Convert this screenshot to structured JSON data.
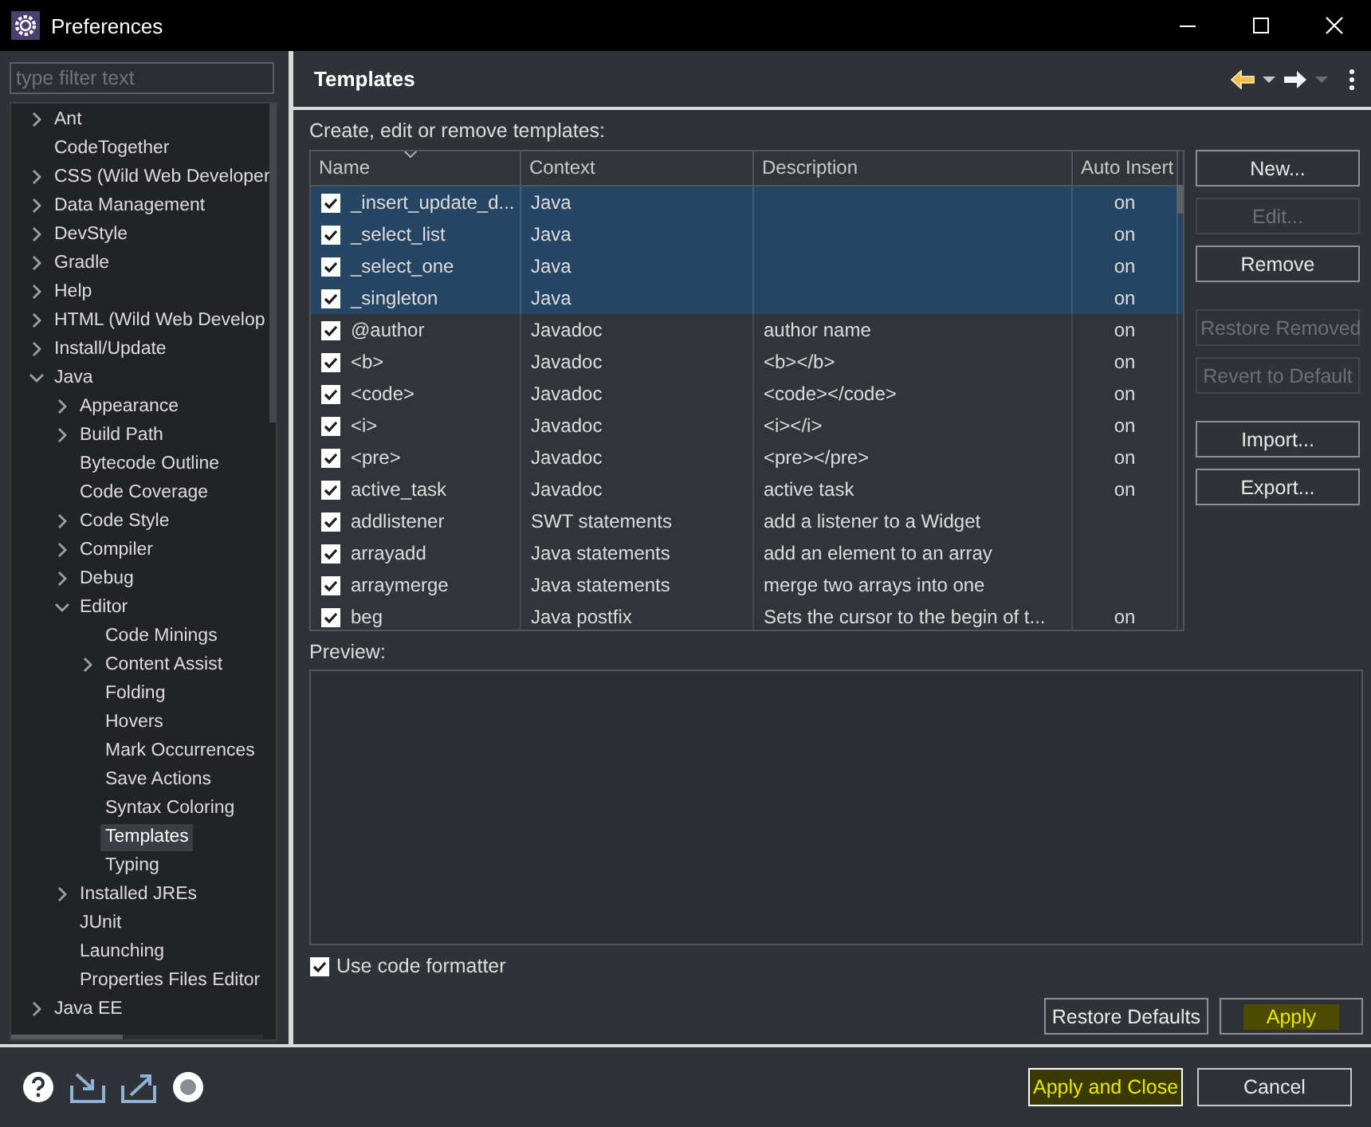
{
  "window": {
    "title": "Preferences"
  },
  "filter": {
    "placeholder": "type filter text"
  },
  "tree": [
    {
      "label": "Ant",
      "expandable": true,
      "expanded": false,
      "selected": false
    },
    {
      "label": "CodeTogether",
      "expandable": false,
      "selected": false
    },
    {
      "label": "CSS (Wild Web Developer",
      "expandable": true,
      "expanded": false,
      "selected": false
    },
    {
      "label": "Data Management",
      "expandable": true,
      "expanded": false,
      "selected": false
    },
    {
      "label": "DevStyle",
      "expandable": true,
      "expanded": false,
      "selected": false
    },
    {
      "label": "Gradle",
      "expandable": true,
      "expanded": false,
      "selected": false
    },
    {
      "label": "Help",
      "expandable": true,
      "expanded": false,
      "selected": false
    },
    {
      "label": "HTML (Wild Web Develop",
      "expandable": true,
      "expanded": false,
      "selected": false
    },
    {
      "label": "Install/Update",
      "expandable": true,
      "expanded": false,
      "selected": false
    },
    {
      "label": "Java",
      "expandable": true,
      "expanded": true,
      "selected": false,
      "children": [
        {
          "label": "Appearance",
          "expandable": true,
          "expanded": false,
          "selected": false
        },
        {
          "label": "Build Path",
          "expandable": true,
          "expanded": false,
          "selected": false
        },
        {
          "label": "Bytecode Outline",
          "expandable": false,
          "selected": false
        },
        {
          "label": "Code Coverage",
          "expandable": false,
          "selected": false
        },
        {
          "label": "Code Style",
          "expandable": true,
          "expanded": false,
          "selected": false
        },
        {
          "label": "Compiler",
          "expandable": true,
          "expanded": false,
          "selected": false
        },
        {
          "label": "Debug",
          "expandable": true,
          "expanded": false,
          "selected": false
        },
        {
          "label": "Editor",
          "expandable": true,
          "expanded": true,
          "selected": false,
          "children": [
            {
              "label": "Code Minings",
              "expandable": false,
              "selected": false
            },
            {
              "label": "Content Assist",
              "expandable": true,
              "expanded": false,
              "selected": false
            },
            {
              "label": "Folding",
              "expandable": false,
              "selected": false
            },
            {
              "label": "Hovers",
              "expandable": false,
              "selected": false
            },
            {
              "label": "Mark Occurrences",
              "expandable": false,
              "selected": false
            },
            {
              "label": "Save Actions",
              "expandable": false,
              "selected": false
            },
            {
              "label": "Syntax Coloring",
              "expandable": false,
              "selected": false
            },
            {
              "label": "Templates",
              "expandable": false,
              "selected": true
            },
            {
              "label": "Typing",
              "expandable": false,
              "selected": false
            }
          ]
        },
        {
          "label": "Installed JREs",
          "expandable": true,
          "expanded": false,
          "selected": false
        },
        {
          "label": "JUnit",
          "expandable": false,
          "selected": false
        },
        {
          "label": "Launching",
          "expandable": false,
          "selected": false
        },
        {
          "label": "Properties Files Editor",
          "expandable": false,
          "selected": false
        }
      ]
    },
    {
      "label": "Java EE",
      "expandable": true,
      "expanded": false,
      "selected": false
    }
  ],
  "page": {
    "title": "Templates",
    "intro": "Create, edit or remove templates:",
    "columns": [
      "Name",
      "Context",
      "Description",
      "Auto Insert"
    ],
    "rows": [
      {
        "checked": true,
        "selected": true,
        "name": "_insert_update_d...",
        "context": "Java",
        "description": "",
        "auto_insert": "on"
      },
      {
        "checked": true,
        "selected": true,
        "name": "_select_list",
        "context": "Java",
        "description": "",
        "auto_insert": "on"
      },
      {
        "checked": true,
        "selected": true,
        "name": "_select_one",
        "context": "Java",
        "description": "",
        "auto_insert": "on"
      },
      {
        "checked": true,
        "selected": true,
        "name": "_singleton",
        "context": "Java",
        "description": "",
        "auto_insert": "on"
      },
      {
        "checked": true,
        "selected": false,
        "name": "@author",
        "context": "Javadoc",
        "description": "author name",
        "auto_insert": "on"
      },
      {
        "checked": true,
        "selected": false,
        "name": "<b>",
        "context": "Javadoc",
        "description": "<b></b>",
        "auto_insert": "on"
      },
      {
        "checked": true,
        "selected": false,
        "name": "<code>",
        "context": "Javadoc",
        "description": "<code></code>",
        "auto_insert": "on"
      },
      {
        "checked": true,
        "selected": false,
        "name": "<i>",
        "context": "Javadoc",
        "description": "<i></i>",
        "auto_insert": "on"
      },
      {
        "checked": true,
        "selected": false,
        "name": "<pre>",
        "context": "Javadoc",
        "description": "<pre></pre>",
        "auto_insert": "on"
      },
      {
        "checked": true,
        "selected": false,
        "name": "active_task",
        "context": "Javadoc",
        "description": "active task",
        "auto_insert": "on"
      },
      {
        "checked": true,
        "selected": false,
        "name": "addlistener",
        "context": "SWT statements",
        "description": "add a listener to a Widget",
        "auto_insert": ""
      },
      {
        "checked": true,
        "selected": false,
        "name": "arrayadd",
        "context": "Java statements",
        "description": "add an element to an array",
        "auto_insert": ""
      },
      {
        "checked": true,
        "selected": false,
        "name": "arraymerge",
        "context": "Java statements",
        "description": "merge two arrays into one",
        "auto_insert": ""
      },
      {
        "checked": true,
        "selected": false,
        "name": "beg",
        "context": "Java postfix",
        "description": "Sets the cursor to the begin of t...",
        "auto_insert": "on"
      }
    ],
    "side_button_groups": [
      [
        {
          "label": "New...",
          "enabled": true
        },
        {
          "label": "Edit...",
          "enabled": false
        },
        {
          "label": "Remove",
          "enabled": true
        }
      ],
      [
        {
          "label": "Restore Removed",
          "enabled": false
        },
        {
          "label": "Revert to Default",
          "enabled": false
        }
      ],
      [
        {
          "label": "Import...",
          "enabled": true
        },
        {
          "label": "Export...",
          "enabled": true
        }
      ]
    ],
    "preview_label": "Preview:",
    "formatter": {
      "label": "Use code formatter",
      "checked": true
    },
    "buttons": [
      {
        "label": "Restore Defaults",
        "highlighted": false
      },
      {
        "label": "Apply",
        "highlighted": true
      }
    ]
  },
  "dialog_buttons": [
    {
      "label": "Apply and Close",
      "highlighted": true
    },
    {
      "label": "Cancel",
      "highlighted": false
    }
  ]
}
